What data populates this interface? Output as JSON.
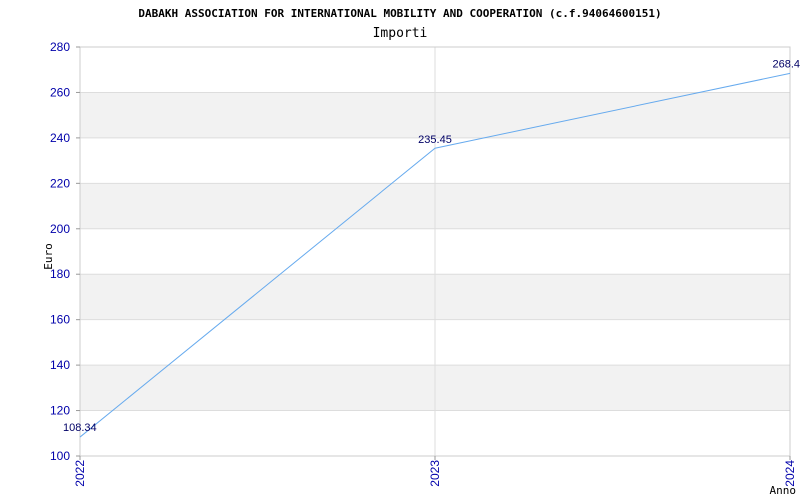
{
  "chart_data": {
    "type": "line",
    "title": "DABAKH ASSOCIATION FOR INTERNATIONAL MOBILITY AND COOPERATION (c.f.94064600151)",
    "subtitle": "Importi",
    "xlabel": "Anno",
    "ylabel": "Euro",
    "x": [
      "2022",
      "2023",
      "2024"
    ],
    "series": [
      {
        "values": [
          108.34,
          235.45,
          268.4
        ],
        "labels": [
          "108.34",
          "235.45",
          "268.4"
        ]
      }
    ],
    "ylim": [
      100,
      280
    ],
    "yticks": [
      "100",
      "120",
      "140",
      "160",
      "180",
      "200",
      "220",
      "240",
      "260",
      "280"
    ],
    "grid": true,
    "colors": {
      "line": "#66aaee",
      "band": "#f2f2f2",
      "grid": "#dddddd",
      "tick": "#0000aa"
    }
  }
}
